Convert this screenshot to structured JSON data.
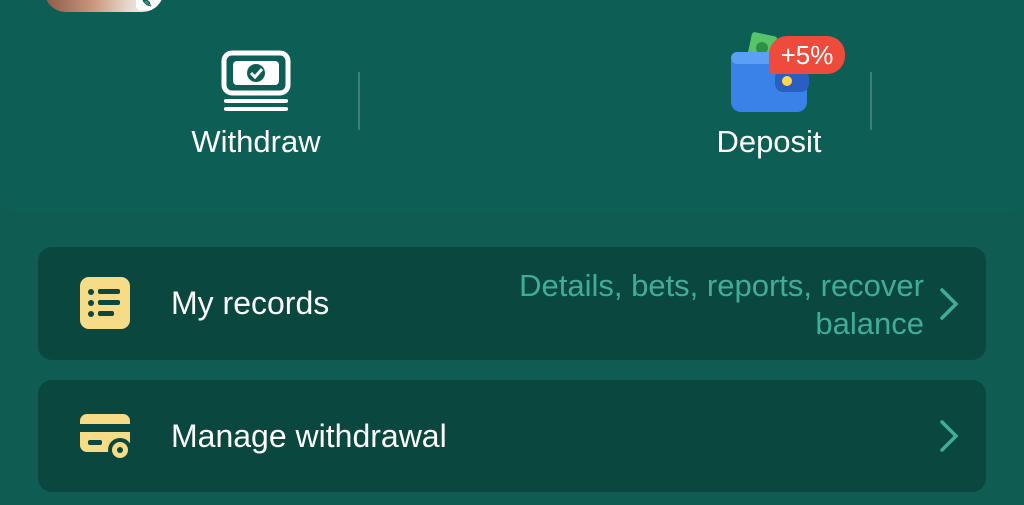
{
  "actions": {
    "withdraw_label": "Withdraw",
    "deposit_label": "Deposit",
    "deposit_bonus": "+5%"
  },
  "menu": {
    "records": {
      "title": "My records",
      "subtitle": "Details, bets, reports, recover balance"
    },
    "withdrawal": {
      "title": "Manage withdrawal"
    }
  },
  "colors": {
    "background": "#0e5c52",
    "card": "#0a473f",
    "accent_text": "#3fae97",
    "icon_yellow": "#f6dc86",
    "badge_red": "#ef4b3c"
  },
  "icons": {
    "withdraw": "cash-check-icon",
    "deposit": "wallet-icon",
    "records": "list-icon",
    "withdrawal": "card-gear-icon",
    "chevron": "chevron-right-icon"
  }
}
